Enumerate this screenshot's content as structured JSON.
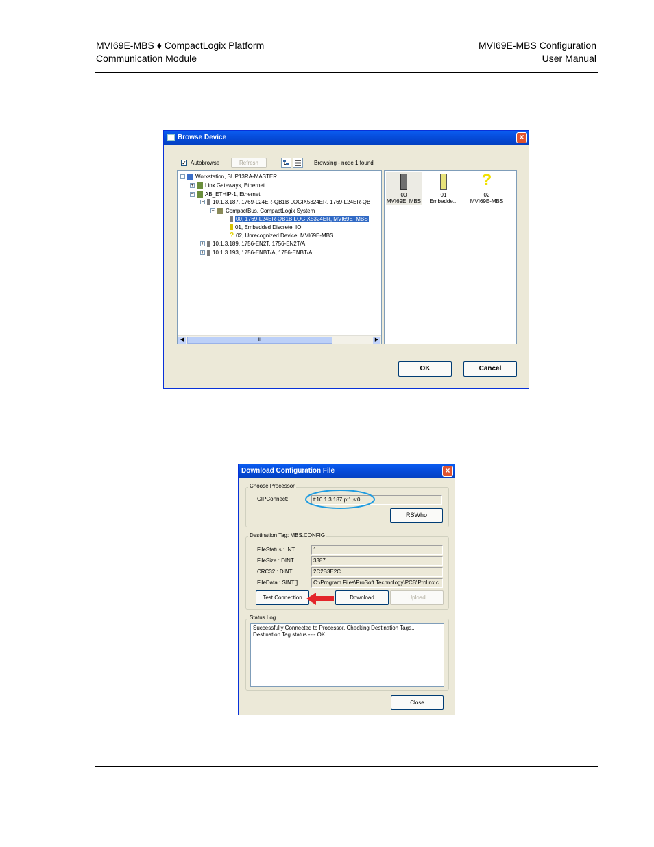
{
  "header": {
    "left_line1": "MVI69E-MBS ♦ CompactLogix Platform",
    "left_line2": "Communication Module",
    "right_line1": "MVI69E-MBS Configuration",
    "right_line2": "User Manual"
  },
  "browse_dialog": {
    "title": "Browse Device",
    "autobrowse_label": "Autobrowse",
    "autobrowse_checked": true,
    "refresh_label": "Refresh",
    "status_text": "Browsing - node 1 found",
    "tree": [
      {
        "label": "Workstation, SUP13RA-MASTER"
      },
      {
        "label": "Linx Gateways, Ethernet"
      },
      {
        "label": "AB_ETHIP-1, Ethernet"
      },
      {
        "label": "10.1.3.187, 1769-L24ER-QB1B LOGIX5324ER, 1769-L24ER-QB"
      },
      {
        "label": "CompactBus, CompactLogix System"
      },
      {
        "label": "00, 1769-L24ER-QB1B LOGIX5324ER, MVI69E_MBS"
      },
      {
        "label": "01, Embedded Discrete_IO"
      },
      {
        "label": "02, Unrecognized Device, MVI69E-MBS"
      },
      {
        "label": "10.1.3.189, 1756-EN2T, 1756-EN2T/A"
      },
      {
        "label": "10.1.3.193, 1756-ENBT/A, 1756-ENBT/A"
      }
    ],
    "icons": [
      {
        "num": "00",
        "name": "MVI69E_MBS"
      },
      {
        "num": "01",
        "name": "Embedde..."
      },
      {
        "num": "02",
        "name": "MVI69E-MBS"
      }
    ],
    "question_mark": "?",
    "scroll_thumb": "III",
    "ok_label": "OK",
    "cancel_label": "Cancel"
  },
  "download_dialog": {
    "title": "Download Configuration File",
    "choose_processor_label": "Choose Processor",
    "cipconnect_label": "CIPConnect:",
    "cipconnect_value": "t:10.1.3.187,p:1,s:0",
    "rswho_label": "RSWho",
    "destination_label": "Destination Tag: MBS.CONFIG",
    "rows": [
      {
        "label": "FileStatus : INT",
        "value": "1"
      },
      {
        "label": "FileSize   : DINT",
        "value": "3387"
      },
      {
        "label": "CRC32     : DINT",
        "value": "2C2B3E2C"
      },
      {
        "label": "FileData   : SINT[]",
        "value": "C:\\Program Files\\ProSoft Technology\\PCB\\Prolinx.c"
      }
    ],
    "test_connection_label": "Test Connection",
    "download_label": "Download",
    "upload_label": "Upload",
    "status_log_label": "Status Log",
    "status_log_lines": [
      "Successfully Connected to Processor. Checking Destination Tags...",
      "Destination Tag status ---- OK"
    ],
    "close_label": "Close"
  },
  "colors": {
    "title_bar": "#0549d6",
    "selection": "#316ac5",
    "highlight_ellipse": "#1e9be0",
    "arrow": "#e3262a"
  }
}
